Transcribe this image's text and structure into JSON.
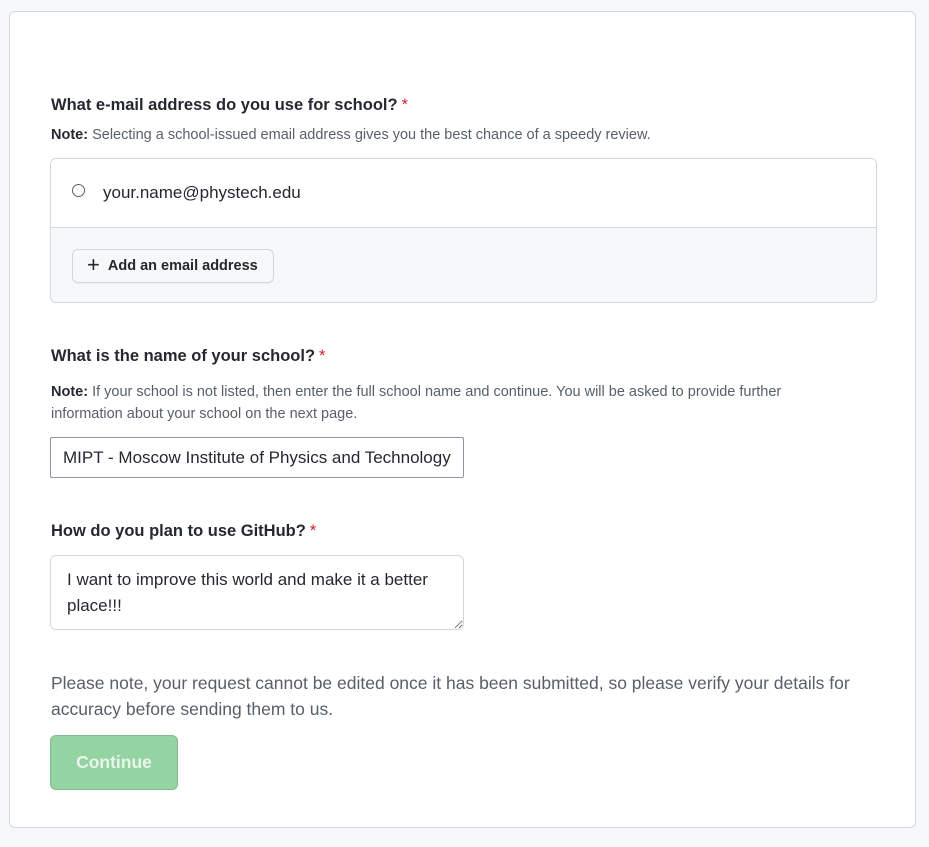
{
  "email_section": {
    "question": "What e-mail address do you use for school?",
    "required_mark": "*",
    "note_label": "Note:",
    "note_text": " Selecting a school-issued email address gives you the best chance of a speedy review.",
    "options": [
      {
        "email": "your.name@phystech.edu",
        "selected": false
      }
    ],
    "add_button_label": "Add an email address",
    "add_icon": "plus-icon"
  },
  "school_section": {
    "question": "What is the name of your school?",
    "required_mark": "*",
    "note_label": "Note:",
    "note_text": " If your school is not listed, then enter the full school name and continue. You will be asked to provide further information about your school on the next page.",
    "value": "MIPT - Moscow Institute of Physics and Technology"
  },
  "usage_section": {
    "question": "How do you plan to use GitHub?",
    "required_mark": "*",
    "value": "I want to improve this world and make it a better place!!!"
  },
  "disclaimer": "Please note, your request cannot be edited once it has been submitted, so please verify your details for accuracy before sending them to us.",
  "continue_button": {
    "label": "Continue",
    "disabled": true
  },
  "colors": {
    "required": "#cf222e",
    "continue_disabled_bg": "#94d3a2",
    "border": "#d0d7de",
    "muted_text": "#57606a"
  }
}
